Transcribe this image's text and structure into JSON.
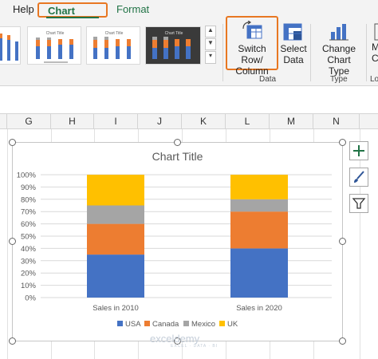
{
  "ribbon": {
    "tabs": [
      {
        "label": "Help"
      },
      {
        "label": "Chart Design"
      },
      {
        "label": "Format"
      }
    ],
    "switch_label_1": "Switch Row/",
    "switch_label_2": "Column",
    "select_label_1": "Select",
    "select_label_2": "Data",
    "change_label_1": "Change",
    "change_label_2": "Chart Type",
    "partial_label_1": "M",
    "partial_label_2": "C",
    "group_data": "Data",
    "group_type": "Type",
    "group_partial": "Lo",
    "gallery_thumb_title": "Chart Title",
    "gallery_up": "▲",
    "gallery_down": "▼",
    "gallery_more": "▾"
  },
  "sheet": {
    "columns": [
      "G",
      "H",
      "I",
      "J",
      "K",
      "L",
      "M",
      "N"
    ]
  },
  "chart": {
    "title": "Chart Title"
  },
  "watermark": {
    "text": "exceldemy",
    "sub": "EXCEL · DATA · BI"
  },
  "colors": {
    "USA": "#4472c4",
    "Canada": "#ed7d31",
    "Mexico": "#a5a5a5",
    "UK": "#ffc000",
    "accent": "#217346",
    "highlight": "#e87722"
  },
  "chart_data": {
    "type": "bar",
    "stacked": "100%",
    "categories": [
      "Sales in 2010",
      "Sales in 2020"
    ],
    "series": [
      {
        "name": "USA",
        "values": [
          35,
          40
        ]
      },
      {
        "name": "Canada",
        "values": [
          25,
          30
        ]
      },
      {
        "name": "Mexico",
        "values": [
          15,
          10
        ]
      },
      {
        "name": "UK",
        "values": [
          25,
          20
        ]
      }
    ],
    "yticks": [
      "0%",
      "10%",
      "20%",
      "30%",
      "40%",
      "50%",
      "60%",
      "70%",
      "80%",
      "90%",
      "100%"
    ],
    "ylim": [
      0,
      100
    ],
    "legend": "bottom",
    "grid": true
  }
}
